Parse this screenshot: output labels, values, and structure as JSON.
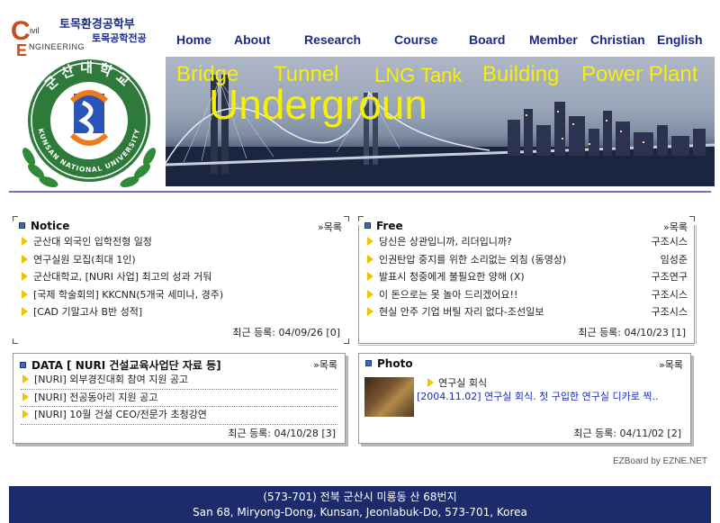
{
  "logo": {
    "dept_line1": "토목환경공학부",
    "dept_line2": "토목공학전공",
    "ce_c": "C",
    "ce_ivil": "ivil",
    "ce_e": "E",
    "ce_ngineering": "NGINEERING",
    "emblem_korean": "군산대학교",
    "emblem_english": "KUNSAN NATIONAL UNIVERSITY"
  },
  "nav": [
    "Home",
    "About",
    "Research",
    "Course",
    "Board",
    "Member",
    "Christian",
    "English"
  ],
  "banner": {
    "words": [
      "Bridge",
      "Tunnel",
      "LNG Tank",
      "Building",
      "Power Plant"
    ],
    "big_word": "Undergroun"
  },
  "notice": {
    "title": "Notice",
    "more": "»목록",
    "items": [
      "군산대 외국인 입학전형 일정",
      "연구실원 모집(최대 1인)",
      "군산대학교, [NURI 사업] 최고의 성과 거둬",
      "[국제 학술회의] KKCNN(5개국 세미나, 경주)",
      "[CAD 기말고사 B반 성적]"
    ],
    "footer": "최근 등록: 04/09/26 [0]"
  },
  "free": {
    "title": "Free",
    "more": "»목록",
    "items": [
      {
        "text": "당신은 상관입니까, 리더입니까?",
        "author": "구조시스"
      },
      {
        "text": "인권탄압 중지를 위한 소리없는 외침 (동영상)",
        "author": "임성준"
      },
      {
        "text": "발표시 청중에게 불필요한 양해 (X)",
        "author": "구조연구"
      },
      {
        "text": "이 돈으로는 못 놀아 드리겠어요!!",
        "author": "구조시스"
      },
      {
        "text": "현실 안주 기업 버틸 자리 없다-조선일보",
        "author": "구조시스"
      }
    ],
    "footer": "최근 등록: 04/10/23 [1]"
  },
  "data_board": {
    "title": "DATA [ NURI 건설교육사업단 자료 등]",
    "more": "»목록",
    "items": [
      "[NURI] 외부경진대회 참여 지원 공고",
      "[NURI] 전공동아리 지원 공고",
      "[NURI] 10월 건설 CEO/전문가 초청강연"
    ],
    "footer": "최근 등록: 04/10/28 [3]"
  },
  "photo_board": {
    "title": "Photo",
    "more": "»목록",
    "item_title": "연구실 회식",
    "item_desc": "[2004.11.02] 연구실 회식. 첫 구입한 연구실 디카로 찍..",
    "footer": "최근 등록: 04/11/02 [2]"
  },
  "ezboard": "EZBoard by EZNE.NET",
  "footer": {
    "line1": "(573-701) 전북 군산시 미룡동 산 68번지",
    "line2": "San 68, Miryong-Dong, Kunsan, Jeonlabuk-Do, 573-701, Korea"
  },
  "colors": {
    "nav": "#1a2b86",
    "banner_text": "#f7f000",
    "footer_bg": "#1c2b6b",
    "accent_square": "#3e6cb4",
    "arrow": "#f2c300"
  }
}
